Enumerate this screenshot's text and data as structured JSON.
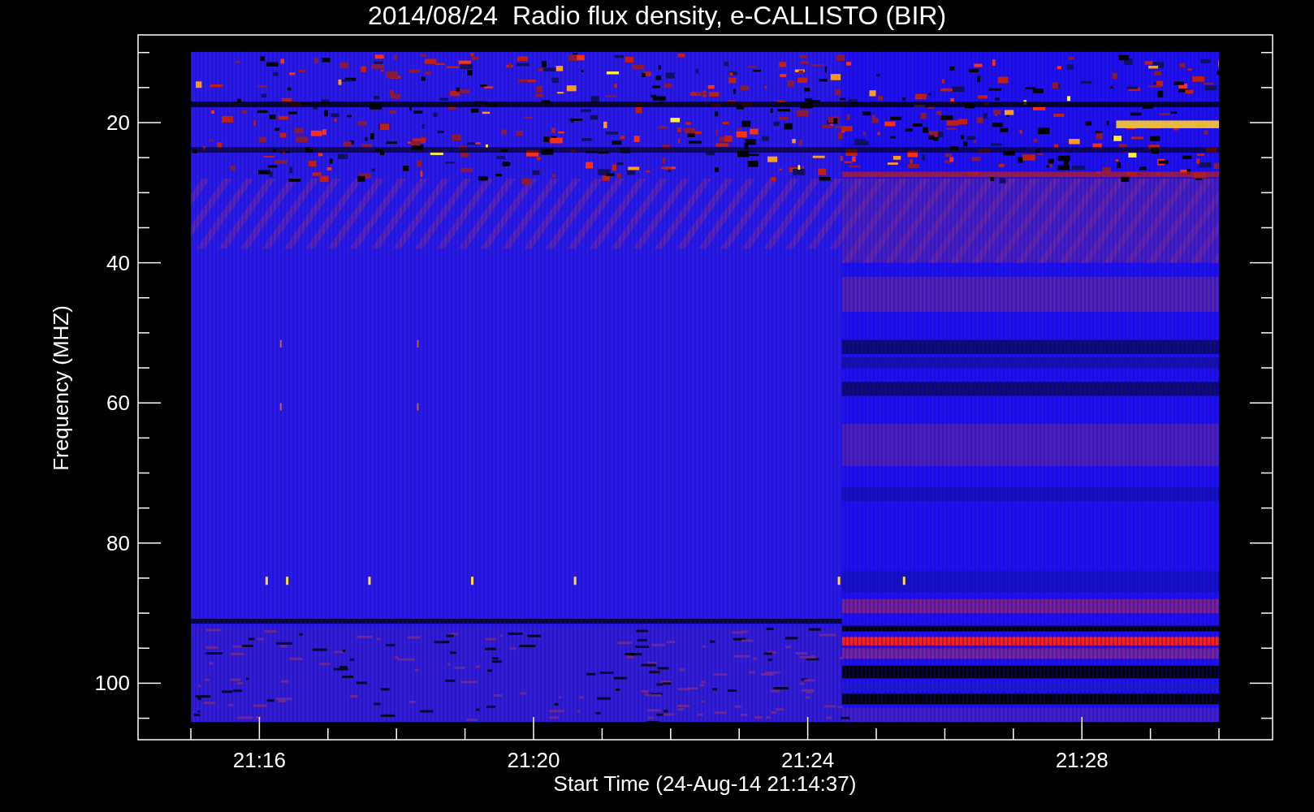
{
  "plot": {
    "title": "2014/08/24  Radio flux density, e-CALLISTO (BIR)",
    "ylabel": "Frequency (MHZ)",
    "xlabel": "Start Time (24-Aug-14 21:14:37)",
    "y_ticks": [
      "20",
      "40",
      "60",
      "80",
      "100"
    ],
    "x_ticks": [
      "21:16",
      "21:20",
      "21:24",
      "21:28"
    ]
  }
}
